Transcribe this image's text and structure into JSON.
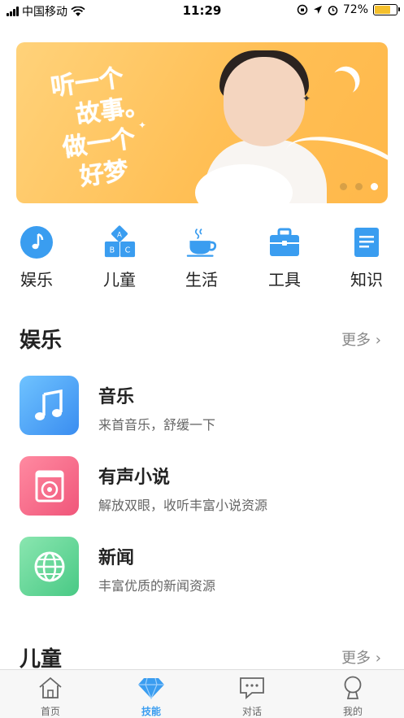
{
  "status_bar": {
    "carrier": "中国移动",
    "time": "11:29",
    "battery": "72%"
  },
  "banner": {
    "line1": "听一个",
    "line2": "故事。",
    "line3": "做一个",
    "line4": "好梦",
    "page_count": 3,
    "active_page": 3
  },
  "categories": [
    {
      "label": "娱乐",
      "icon": "music-note-icon"
    },
    {
      "label": "儿童",
      "icon": "abc-blocks-icon"
    },
    {
      "label": "生活",
      "icon": "coffee-cup-icon"
    },
    {
      "label": "工具",
      "icon": "toolbox-icon"
    },
    {
      "label": "知识",
      "icon": "book-icon"
    }
  ],
  "section_entertainment": {
    "title": "娱乐",
    "more": "更多"
  },
  "items": [
    {
      "title": "音乐",
      "subtitle": "来首音乐，舒缓一下",
      "icon": "music-note-icon",
      "color": "#4aa3f7"
    },
    {
      "title": "有声小说",
      "subtitle": "解放双眼，收听丰富小说资源",
      "icon": "audiobook-icon",
      "color": "#f26a85"
    },
    {
      "title": "新闻",
      "subtitle": "丰富优质的新闻资源",
      "icon": "globe-icon",
      "color": "#5fd08f"
    }
  ],
  "section_children": {
    "title": "儿童",
    "more": "更多"
  },
  "tabs": [
    {
      "label": "首页",
      "icon": "home-icon",
      "active": false
    },
    {
      "label": "技能",
      "icon": "diamond-icon",
      "active": true
    },
    {
      "label": "对话",
      "icon": "chat-icon",
      "active": false
    },
    {
      "label": "我的",
      "icon": "user-icon",
      "active": false
    }
  ],
  "colors": {
    "accent": "#3a9df0",
    "banner_bg": "#ffc25a"
  }
}
